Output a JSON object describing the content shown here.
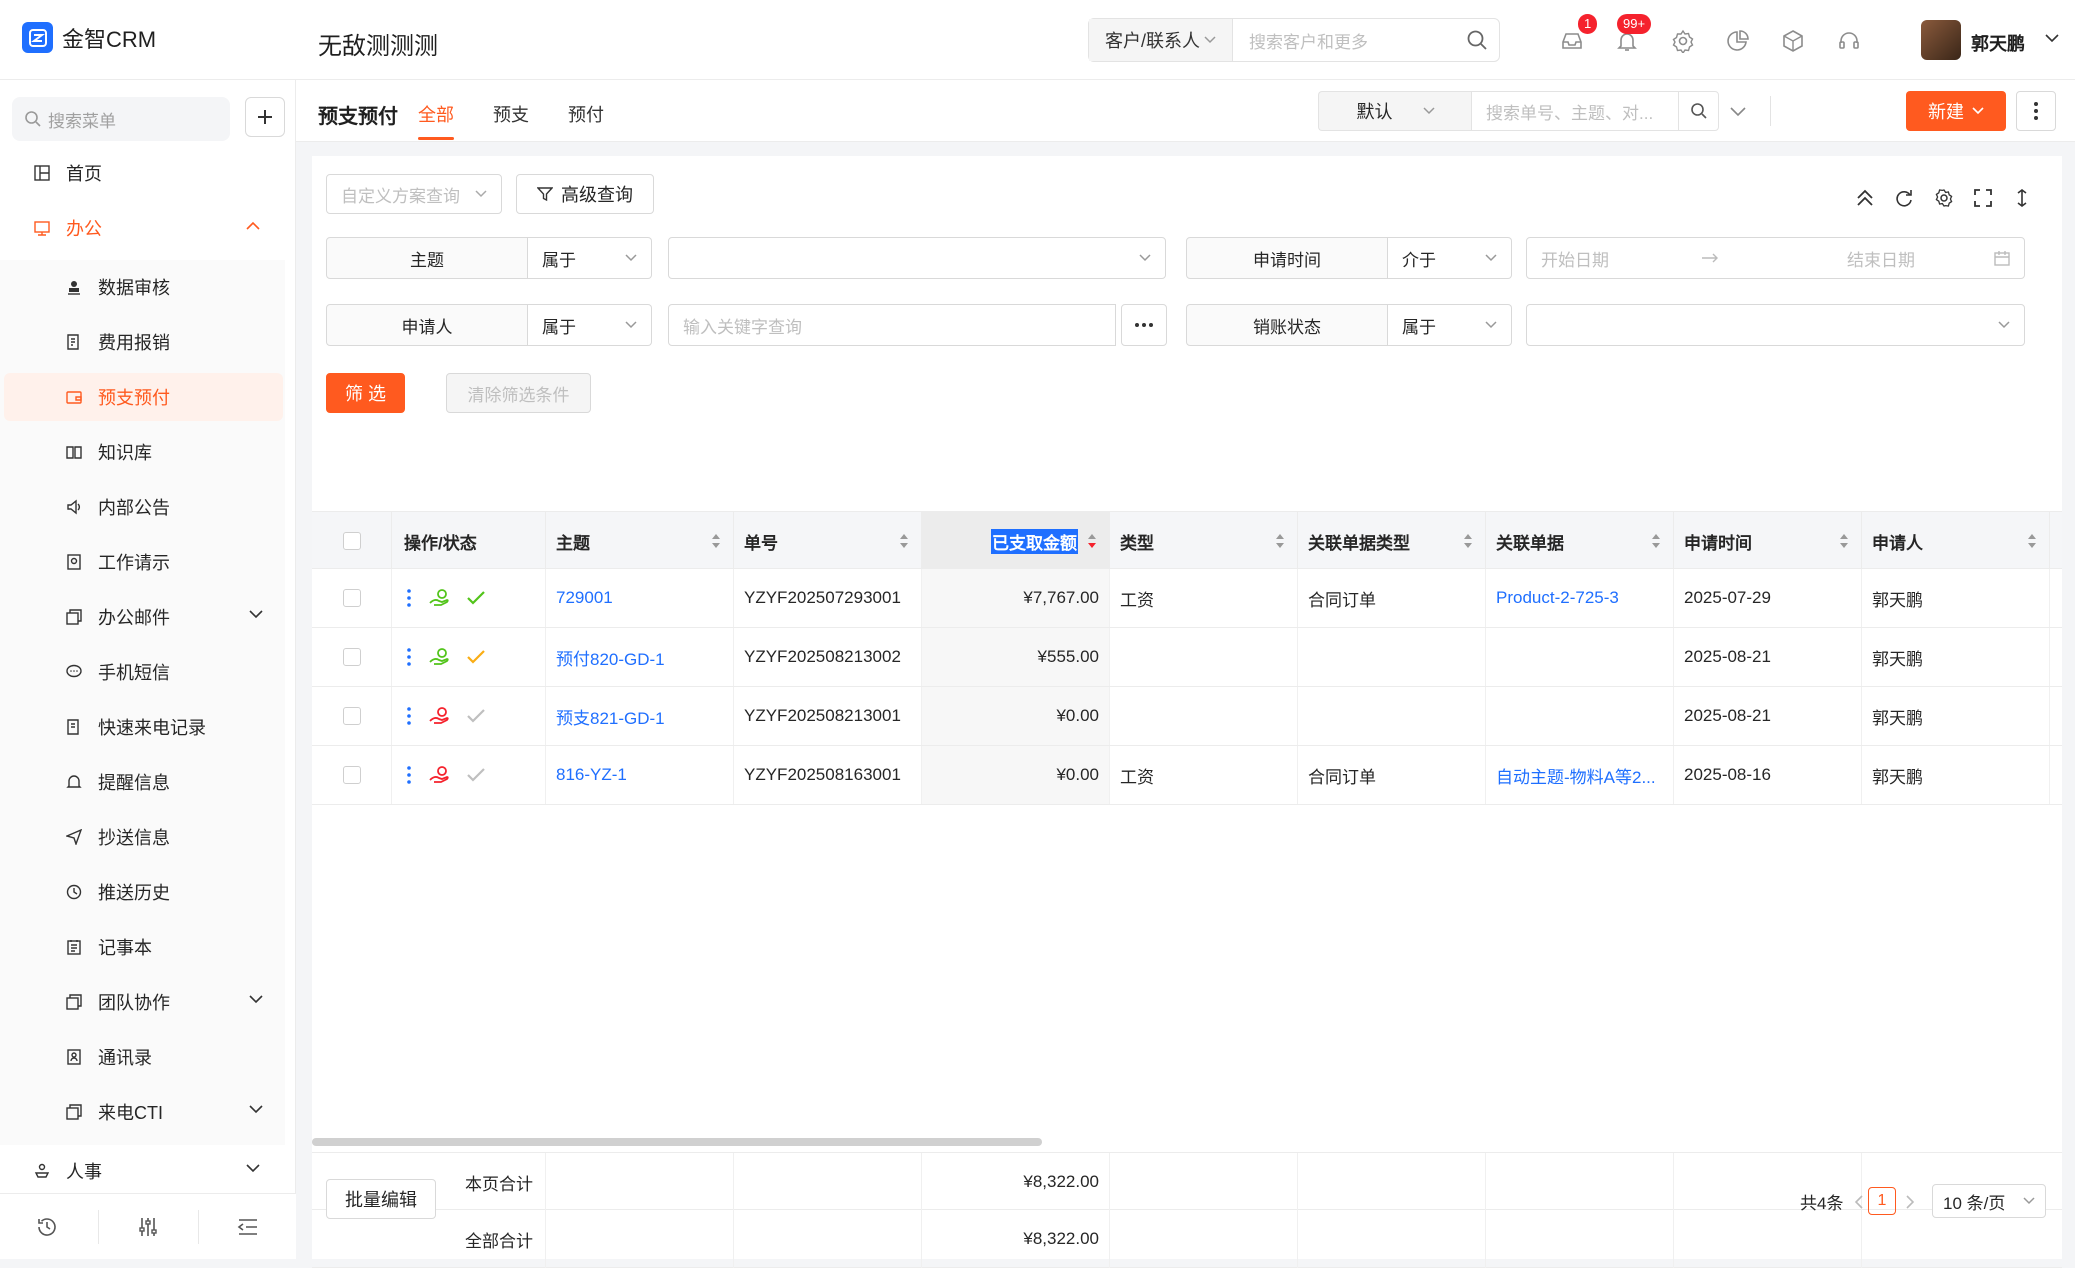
{
  "app": {
    "brand": "金智CRM",
    "workspace": "无敌测测测"
  },
  "topbar": {
    "search_scope": "客户/联系人",
    "search_placeholder": "搜索客户和更多",
    "mail_badge": "1",
    "notify_badge": "99+",
    "user_name": "郭天鹏"
  },
  "sidebar": {
    "search_placeholder": "搜索菜单",
    "home": "首页",
    "office": "办公",
    "items": [
      {
        "label": "数据审核",
        "icon": "stamp-icon"
      },
      {
        "label": "费用报销",
        "icon": "receipt-icon"
      },
      {
        "label": "预支预付",
        "icon": "wallet-icon"
      },
      {
        "label": "知识库",
        "icon": "book-icon"
      },
      {
        "label": "内部公告",
        "icon": "speaker-icon"
      },
      {
        "label": "工作请示",
        "icon": "request-icon"
      },
      {
        "label": "办公邮件",
        "icon": "mail-icon"
      },
      {
        "label": "手机短信",
        "icon": "message-icon"
      },
      {
        "label": "快速来电记录",
        "icon": "call-log-icon"
      },
      {
        "label": "提醒信息",
        "icon": "bell-icon"
      },
      {
        "label": "抄送信息",
        "icon": "send-icon"
      },
      {
        "label": "推送历史",
        "icon": "clock-icon"
      },
      {
        "label": "记事本",
        "icon": "notepad-icon"
      },
      {
        "label": "团队协作",
        "icon": "team-icon"
      },
      {
        "label": "通讯录",
        "icon": "contacts-icon"
      },
      {
        "label": "来电CTI",
        "icon": "cti-icon"
      }
    ],
    "hr": "人事"
  },
  "page": {
    "title": "预支预付",
    "tabs": [
      "全部",
      "预支",
      "预付"
    ],
    "view_select": "默认",
    "search_placeholder": "搜索单号、主题、对...",
    "new_button": "新建"
  },
  "filters": {
    "custom_query_placeholder": "自定义方案查询",
    "advanced_button": "高级查询",
    "subject_label": "主题",
    "subject_op": "属于",
    "apply_time_label": "申请时间",
    "apply_time_op": "介于",
    "start_placeholder": "开始日期",
    "end_placeholder": "结束日期",
    "applicant_label": "申请人",
    "applicant_op": "属于",
    "keyword_placeholder": "输入关键字查询",
    "writeoff_label": "销账状态",
    "writeoff_op": "属于",
    "filter_button": "筛 选",
    "clear_button": "清除筛选条件"
  },
  "table": {
    "columns": [
      "操作/状态",
      "主题",
      "单号",
      "已支取金额",
      "类型",
      "关联单据类型",
      "关联单据",
      "申请时间",
      "申请人"
    ],
    "rows": [
      {
        "subject": "729001",
        "number": "YZYF202507293001",
        "amount": "¥7,767.00",
        "type": "工资",
        "ref_type": "合同订单",
        "ref": "Product-2-725-3",
        "date": "2025-07-29",
        "applicant": "郭天鹏",
        "hand_color": "#52c41a",
        "check_color": "#52c41a"
      },
      {
        "subject": "预付820-GD-1",
        "number": "YZYF202508213002",
        "amount": "¥555.00",
        "type": "",
        "ref_type": "",
        "ref": "",
        "date": "2025-08-21",
        "applicant": "郭天鹏",
        "hand_color": "#52c41a",
        "check_color": "#faad14"
      },
      {
        "subject": "预支821-GD-1",
        "number": "YZYF202508213001",
        "amount": "¥0.00",
        "type": "",
        "ref_type": "",
        "ref": "",
        "date": "2025-08-21",
        "applicant": "郭天鹏",
        "hand_color": "#f5222d",
        "check_color": "#bfbfbf"
      },
      {
        "subject": "816-YZ-1",
        "number": "YZYF202508163001",
        "amount": "¥0.00",
        "type": "工资",
        "ref_type": "合同订单",
        "ref": "自动主题-物料A等2...",
        "date": "2025-08-16",
        "applicant": "郭天鹏",
        "hand_color": "#f5222d",
        "check_color": "#bfbfbf"
      }
    ],
    "page_total_label": "本页合计",
    "page_total": "¥8,322.00",
    "all_total_label": "全部合计",
    "all_total": "¥8,322.00"
  },
  "footer": {
    "batch_edit": "批量编辑",
    "total_count": "共4条",
    "current_page": "1",
    "page_size": "10 条/页"
  },
  "colors": {
    "accent": "#ff5a1f",
    "link": "#1f6fff",
    "brand_logo": "#1f6fff"
  }
}
